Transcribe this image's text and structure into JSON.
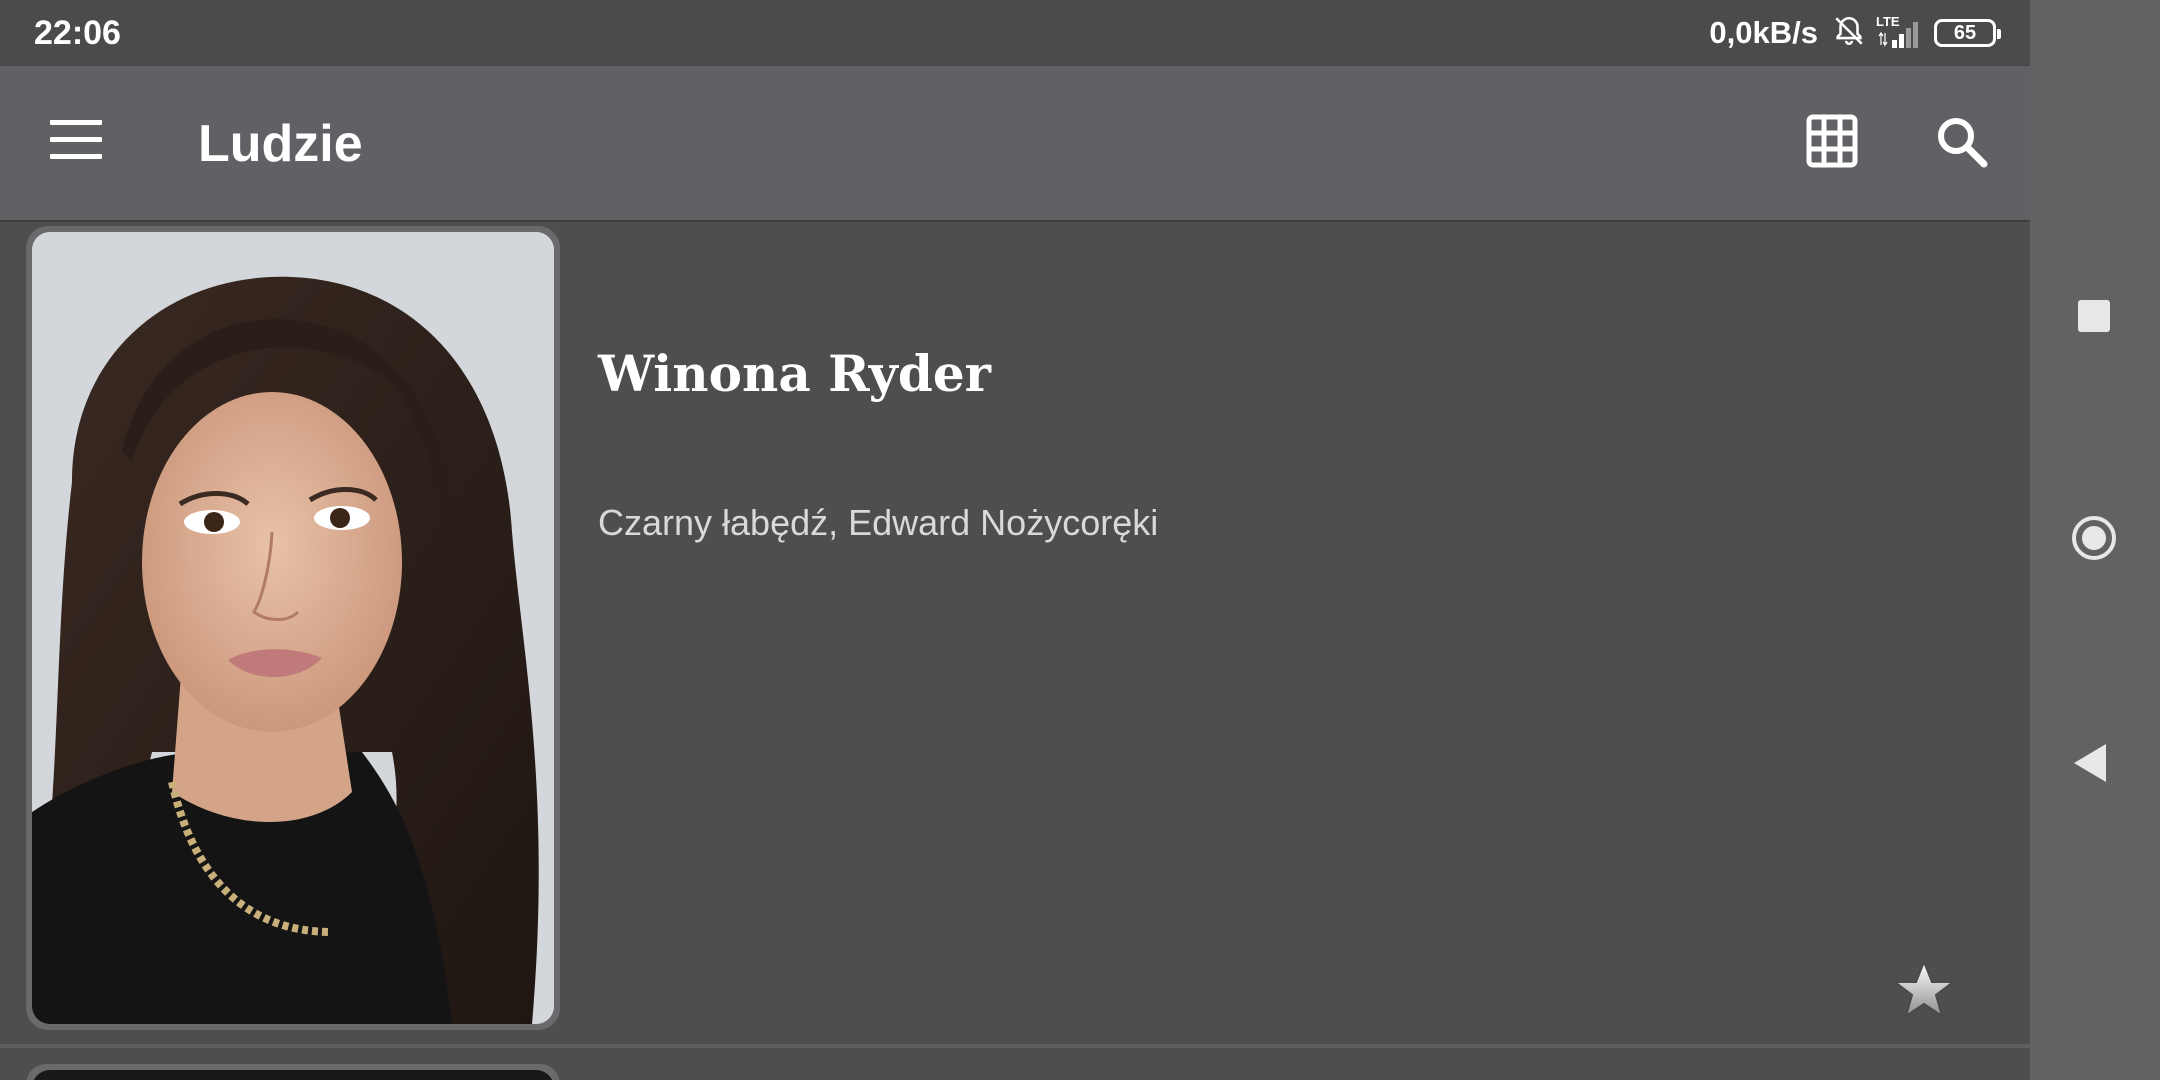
{
  "status_bar": {
    "time": "22:06",
    "network_speed": "0,0kB/s",
    "network_type": "LTE",
    "battery": "65",
    "icons": [
      "bell-off-icon",
      "signal-icon",
      "battery-icon"
    ]
  },
  "app_bar": {
    "title": "Ludzie",
    "icons": [
      "menu-icon",
      "grid-icon",
      "search-icon"
    ]
  },
  "people": [
    {
      "name": "Winona Ryder",
      "known_for": "Czarny łabędź, Edward Nożycoręki",
      "favorite_icon": "star-icon"
    }
  ],
  "nav_bar": {
    "icons": [
      "recents-icon",
      "home-icon",
      "back-icon"
    ]
  },
  "colors": {
    "app_bar": "#606164",
    "background": "#4e4e4f",
    "status_bar": "#4b4b4c",
    "nav_bar": "#616264"
  }
}
